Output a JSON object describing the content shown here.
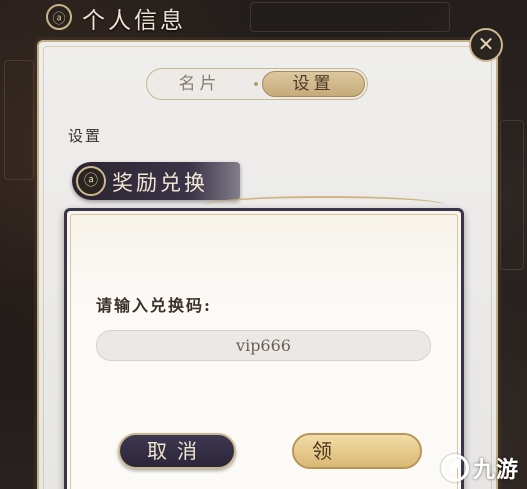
{
  "header": {
    "title": "个人信息",
    "emblem": "ⓐ"
  },
  "tabs": [
    {
      "label": "名片",
      "active": false
    },
    {
      "label": "设置",
      "active": true
    }
  ],
  "close_icon": "✕",
  "section": {
    "label": "设置"
  },
  "reward": {
    "title": "奖励兑换",
    "emblem": "ⓐ"
  },
  "dialog": {
    "prompt": "请输入兑换码:",
    "code_value": "vip666",
    "cancel_label": "取消",
    "claim_label": "领"
  },
  "watermark": {
    "text": "九游"
  },
  "colors": {
    "accent_gold": "#c9b48a",
    "dark_banner": "#3a3448",
    "panel_bg": "#efeeec"
  }
}
